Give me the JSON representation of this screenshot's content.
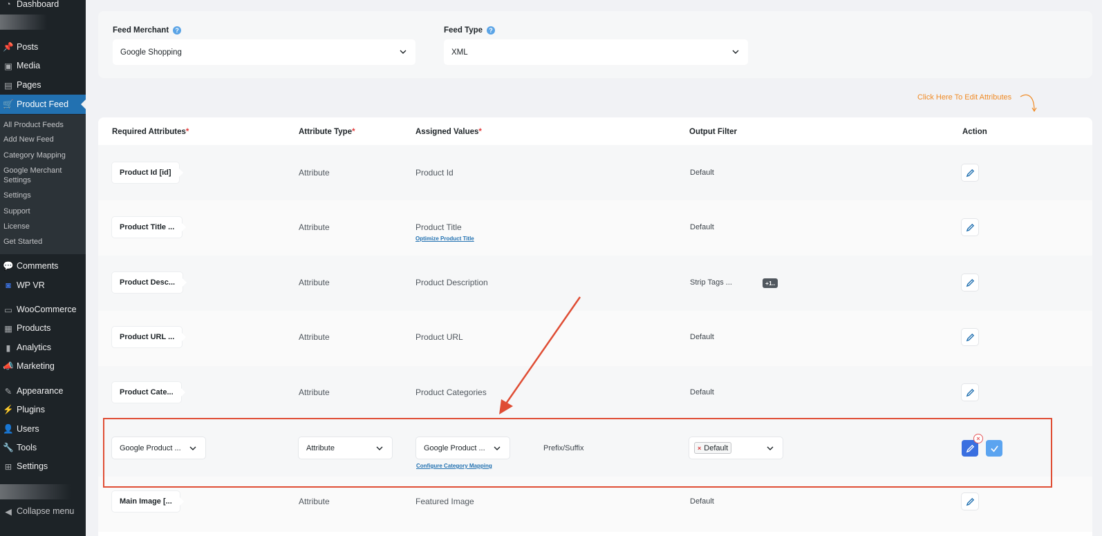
{
  "sidebar": {
    "items": [
      {
        "label": "Dashboard",
        "icon": "dashboard-icon"
      },
      {
        "label": "Posts",
        "icon": "pin-icon"
      },
      {
        "label": "Media",
        "icon": "media-icon"
      },
      {
        "label": "Pages",
        "icon": "pages-icon"
      },
      {
        "label": "Product Feed",
        "icon": "cart-icon"
      },
      {
        "label": "Comments",
        "icon": "comment-icon"
      },
      {
        "label": "WP VR",
        "icon": "vr-icon"
      },
      {
        "label": "WooCommerce",
        "icon": "woo-icon"
      },
      {
        "label": "Products",
        "icon": "products-icon"
      },
      {
        "label": "Analytics",
        "icon": "analytics-icon"
      },
      {
        "label": "Marketing",
        "icon": "megaphone-icon"
      },
      {
        "label": "Appearance",
        "icon": "brush-icon"
      },
      {
        "label": "Plugins",
        "icon": "plug-icon"
      },
      {
        "label": "Users",
        "icon": "user-icon"
      },
      {
        "label": "Tools",
        "icon": "wrench-icon"
      },
      {
        "label": "Settings",
        "icon": "settings-icon"
      },
      {
        "label": "Collapse menu",
        "icon": "collapse-icon"
      }
    ],
    "submenu": [
      "All Product Feeds",
      "Add New Feed",
      "Category Mapping",
      "Google Merchant Settings",
      "Settings",
      "Support",
      "License",
      "Get Started"
    ]
  },
  "feed": {
    "merchant_label": "Feed Merchant",
    "merchant_value": "Google Shopping",
    "type_label": "Feed Type",
    "type_value": "XML"
  },
  "hint": "Click Here To Edit Attributes",
  "table": {
    "headers": {
      "required": "Required Attributes",
      "type": "Attribute Type",
      "assigned": "Assigned Values",
      "filter": "Output Filter",
      "action": "Action"
    },
    "rows": [
      {
        "attr": "Product Id [id]",
        "type": "Attribute",
        "value": "Product Id",
        "filter": "Default"
      },
      {
        "attr": "Product Title ...",
        "type": "Attribute",
        "value": "Product Title",
        "sublink": "Optimize Product Title",
        "filter": "Default"
      },
      {
        "attr": "Product Desc...",
        "type": "Attribute",
        "value": "Product Description",
        "filter": "Strip Tags ...",
        "badge": "+1.."
      },
      {
        "attr": "Product URL ...",
        "type": "Attribute",
        "value": "Product URL",
        "filter": "Default"
      },
      {
        "attr": "Product Cate...",
        "type": "Attribute",
        "value": "Product Categories",
        "filter": "Default"
      },
      {
        "attr": "Main Image [...",
        "type": "Attribute",
        "value": "Featured Image",
        "filter": "Default"
      }
    ],
    "edit_row": {
      "attr": "Google Product ...",
      "type": "Attribute",
      "value": "Google Product ...",
      "sublink": "Configure Category Mapping",
      "prefix": "Prefix/Suffix",
      "filter_chip": "Default"
    }
  },
  "colors": {
    "accent": "#2271b1",
    "highlight": "#df4d34",
    "hint": "#f08a24"
  }
}
